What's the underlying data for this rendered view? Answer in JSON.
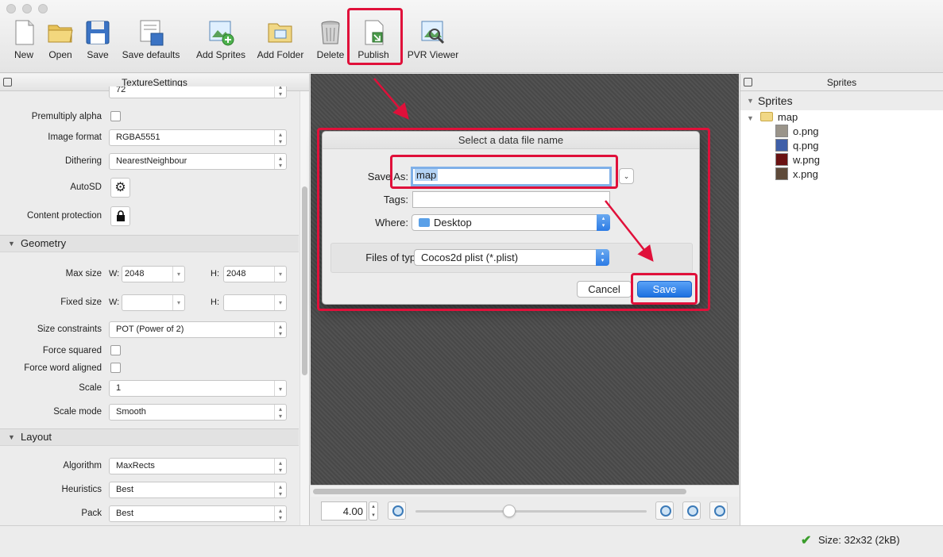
{
  "toolbar": {
    "buttons": [
      {
        "label": "New",
        "icon": "new-document-icon"
      },
      {
        "label": "Open",
        "icon": "open-folder-icon"
      },
      {
        "label": "Save",
        "icon": "save-disk-icon"
      },
      {
        "label": "Save defaults",
        "icon": "save-defaults-icon"
      },
      {
        "label": "Add Sprites",
        "icon": "add-sprites-icon"
      },
      {
        "label": "Add Folder",
        "icon": "add-folder-icon"
      },
      {
        "label": "Delete",
        "icon": "trash-icon"
      },
      {
        "label": "Publish",
        "icon": "publish-icon"
      },
      {
        "label": "PVR Viewer",
        "icon": "pvr-viewer-icon"
      }
    ]
  },
  "texture_settings": {
    "title": "TextureSettings",
    "dpi_value": "72",
    "premultiply_alpha_label": "Premultiply alpha",
    "image_format_label": "Image format",
    "image_format_value": "RGBA5551",
    "dithering_label": "Dithering",
    "dithering_value": "NearestNeighbour",
    "autosd_label": "AutoSD",
    "content_protection_label": "Content protection",
    "geometry_section": "Geometry",
    "max_size_label": "Max size",
    "w_label": "W:",
    "h_label": "H:",
    "max_w": "2048",
    "max_h": "2048",
    "fixed_size_label": "Fixed size",
    "size_constraints_label": "Size constraints",
    "size_constraints_value": "POT (Power of 2)",
    "force_squared_label": "Force squared",
    "force_word_aligned_label": "Force word aligned",
    "scale_label": "Scale",
    "scale_value": "1",
    "scale_mode_label": "Scale mode",
    "scale_mode_value": "Smooth",
    "layout_section": "Layout",
    "algorithm_label": "Algorithm",
    "algorithm_value": "MaxRects",
    "heuristics_label": "Heuristics",
    "heuristics_value": "Best",
    "pack_label": "Pack",
    "pack_value": "Best"
  },
  "canvas": {
    "zoom_value": "4.00"
  },
  "sprites": {
    "title": "Sprites",
    "root_label": "Sprites",
    "folder_label": "map",
    "files": [
      {
        "name": "o.png",
        "color": "#9a948a"
      },
      {
        "name": "q.png",
        "color": "#3f5fa8"
      },
      {
        "name": "w.png",
        "color": "#6a1212"
      },
      {
        "name": "x.png",
        "color": "#5e4a3a"
      }
    ]
  },
  "status": {
    "size_text": "Size: 32x32 (2kB)"
  },
  "dialog": {
    "title": "Select a data file name",
    "save_as_label": "Save As:",
    "save_as_value": "map",
    "tags_label": "Tags:",
    "tags_value": "",
    "where_label": "Where:",
    "where_value": "Desktop",
    "files_of_type_label": "Files of type:",
    "files_of_type_value": "Cocos2d plist (*.plist)",
    "cancel_label": "Cancel",
    "save_label": "Save"
  },
  "colors": {
    "highlight": "#e0103a",
    "accent": "#2c7be5"
  }
}
